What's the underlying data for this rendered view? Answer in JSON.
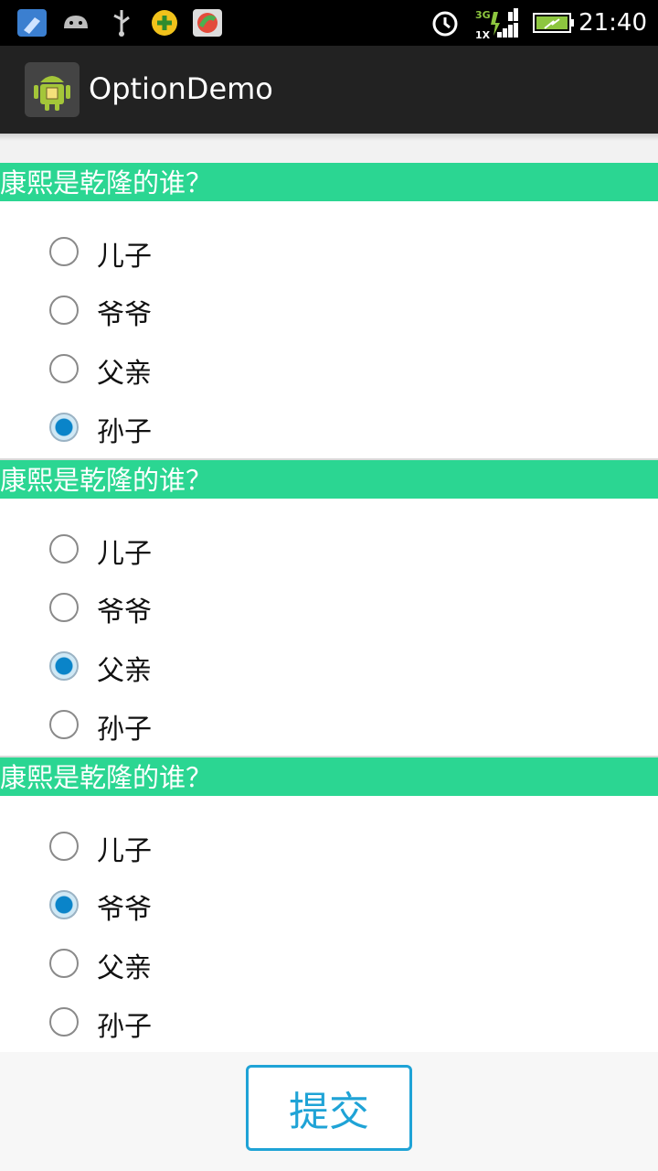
{
  "status_bar": {
    "time": "21:40",
    "network": "3G",
    "network_sub": "1X",
    "icons": [
      "cleaner-icon",
      "android-debug-icon",
      "usb-icon",
      "game-icon",
      "app-store-icon",
      "alarm-icon",
      "signal-icon",
      "battery-icon"
    ]
  },
  "action_bar": {
    "title": "OptionDemo"
  },
  "questions": [
    {
      "text": "康熙是乾隆的谁？",
      "options": [
        "儿子",
        "爷爷",
        "父亲",
        "孙子"
      ],
      "selected_index": 3
    },
    {
      "text": "康熙是乾隆的谁？",
      "options": [
        "儿子",
        "爷爷",
        "父亲",
        "孙子"
      ],
      "selected_index": 2
    },
    {
      "text": "康熙是乾隆的谁？",
      "options": [
        "儿子",
        "爷爷",
        "父亲",
        "孙子"
      ],
      "selected_index": 1
    }
  ],
  "submit_label": "提交",
  "colors": {
    "header": "#2bd692",
    "accent": "#1fa3d6",
    "radio_selected": "#0a84c9"
  }
}
